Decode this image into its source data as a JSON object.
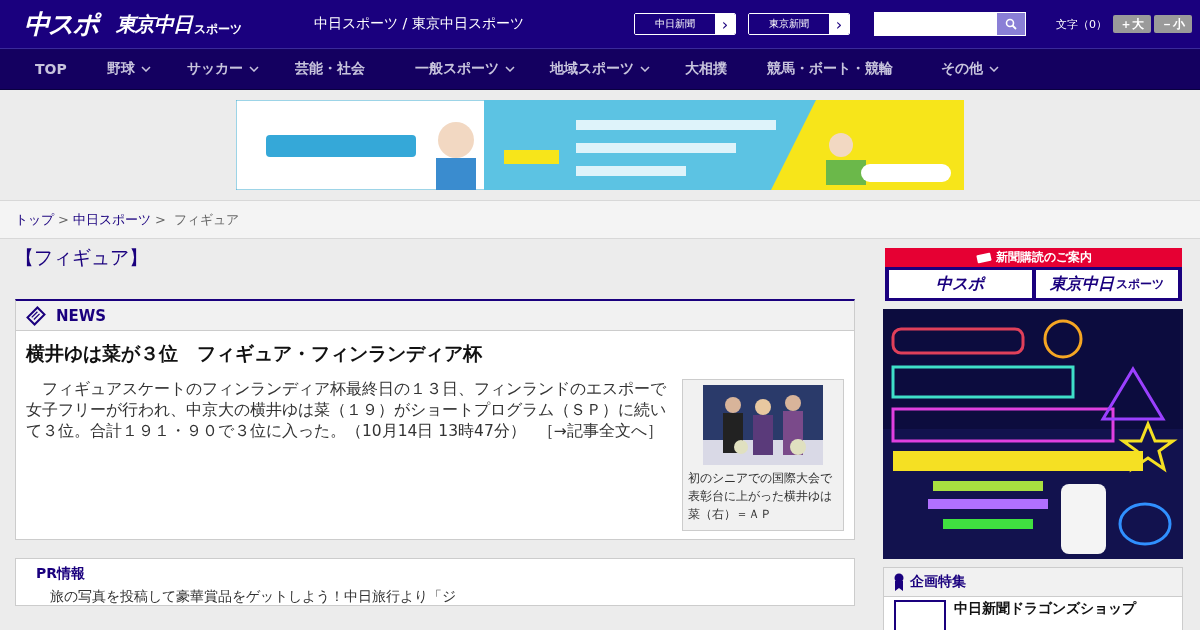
{
  "header": {
    "logo_main": "中スポ",
    "logo_tokyo": "東京中日",
    "logo_tokyo_sub": "スポーツ",
    "site_title": "中日スポーツ / 東京中日スポーツ",
    "papers": [
      {
        "label": "中日新聞",
        "arrow": "›"
      },
      {
        "label": "東京新聞",
        "arrow": "›"
      }
    ],
    "font_size": {
      "label": "文字（0）",
      "buttons": [
        "＋大",
        "－小"
      ]
    }
  },
  "nav": [
    {
      "label": "TOP",
      "has_menu": false
    },
    {
      "label": "野球",
      "has_menu": true
    },
    {
      "label": "サッカー",
      "has_menu": true
    },
    {
      "label": "芸能・社会",
      "has_menu": false
    },
    {
      "label": "一般スポーツ",
      "has_menu": true
    },
    {
      "label": "地域スポーツ",
      "has_menu": true
    },
    {
      "label": "大相撲",
      "has_menu": false
    },
    {
      "label": "競馬・ボート・競輪",
      "has_menu": false
    },
    {
      "label": "その他",
      "has_menu": true
    }
  ],
  "breadcrumb": [
    {
      "label": "トップ",
      "link": true
    },
    {
      "label": "中日スポーツ",
      "link": true
    },
    {
      "label": "フィギュア",
      "link": false
    }
  ],
  "breadcrumb_separators": [
    ">",
    ">"
  ],
  "page_title": "【フィギュア】",
  "news": {
    "heading": "NEWS",
    "headline": "横井ゆは菜が３位　フィギュア・フィンランディア杯",
    "body": "　フィギュアスケートのフィンランディア杯最終日の１３日、フィンランドのエスポーで女子フリーが行われ、中京大の横井ゆは菜（１９）がショートプログラム（ＳＰ）に続いて３位。合計１９１・９０で３位に入った。",
    "timestamp": "（10月14日 13時47分）",
    "more_link": "［→記事全文へ］",
    "photo_caption": "初のシニアでの国際大会で表彰台に上がった横井ゆは菜（右）＝ＡＰ"
  },
  "pr": {
    "heading": "PR情報",
    "text": "　旅の写真を投稿して豪華賞品をゲットしよう！中日旅行より「ジ"
  },
  "subscribe": {
    "title": "新聞購読のご案内",
    "logos": [
      "中スポ",
      "東京中日"
    ],
    "logo_sub": "スポーツ"
  },
  "features": {
    "heading": "企画特集",
    "items": [
      "中日新聞ドラゴンズショップ"
    ]
  }
}
